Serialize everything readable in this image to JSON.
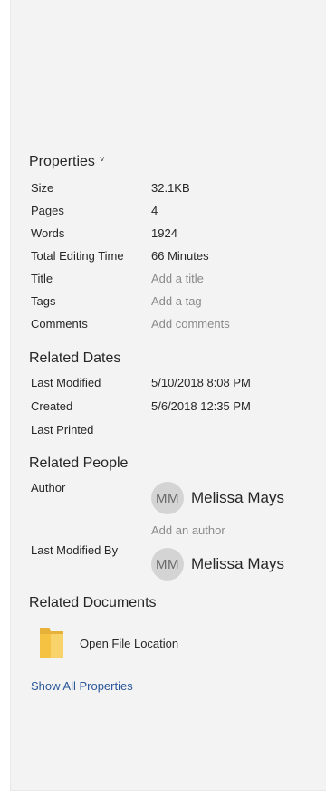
{
  "properties": {
    "heading": "Properties",
    "caret": "˅",
    "rows": [
      {
        "label": "Size",
        "value": "32.1KB"
      },
      {
        "label": "Pages",
        "value": "4"
      },
      {
        "label": "Words",
        "value": "1924"
      },
      {
        "label": "Total Editing Time",
        "value": "66 Minutes"
      },
      {
        "label": "Title",
        "value": "Add a title"
      },
      {
        "label": "Tags",
        "value": "Add a tag"
      },
      {
        "label": "Comments",
        "value": "Add comments"
      }
    ]
  },
  "related_dates": {
    "heading": "Related Dates",
    "rows": [
      {
        "label": "Last Modified",
        "value": "5/10/2018 8:08 PM"
      },
      {
        "label": "Created",
        "value": "5/6/2018 12:35 PM"
      },
      {
        "label": "Last Printed",
        "value": ""
      }
    ]
  },
  "related_people": {
    "heading": "Related People",
    "author_label": "Author",
    "author_initials": "MM",
    "author_name": "Melissa Mays",
    "add_author": "Add an author",
    "last_modified_by_label": "Last Modified By",
    "modifier_initials": "MM",
    "modifier_name": "Melissa Mays"
  },
  "related_documents": {
    "heading": "Related Documents",
    "open_file_location": "Open File Location",
    "icon": "folder-icon"
  },
  "show_all_properties": "Show All Properties",
  "colors": {
    "panel_bg": "#f3f3f3",
    "link": "#2b579a",
    "placeholder": "#8a8a8a",
    "folder": "#f5c242"
  }
}
